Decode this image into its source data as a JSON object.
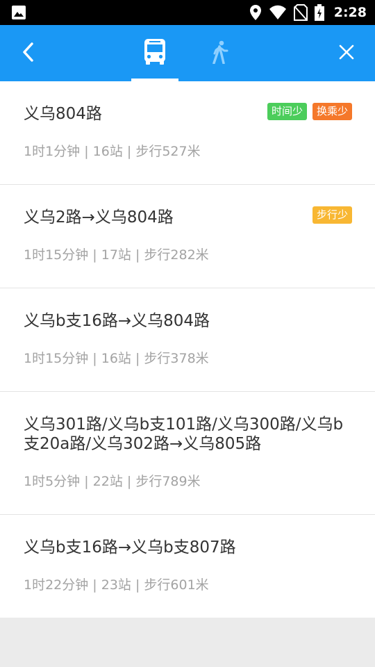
{
  "status_bar": {
    "time": "2:28",
    "icons": [
      "image-icon",
      "location-icon",
      "wifi-icon",
      "no-sim-icon",
      "battery-icon"
    ]
  },
  "app_bar": {
    "back_icon": "back-arrow-icon",
    "tabs": [
      {
        "icon": "bus-icon",
        "selected": true
      },
      {
        "icon": "walk-icon",
        "selected": false
      }
    ],
    "close_icon": "close-icon"
  },
  "colors": {
    "app_bar": "#1a98f5",
    "badge_green": "#4ccd5b",
    "badge_orange": "#f5782a",
    "badge_yellow": "#f8b733"
  },
  "routes": [
    {
      "title": "义乌804路",
      "meta": "1时1分钟 | 16站 | 步行527米",
      "badges": [
        "时间少",
        "换乘少"
      ]
    },
    {
      "title": "义乌2路→义乌804路",
      "meta": "1时15分钟 | 17站 | 步行282米",
      "badges": [
        "步行少"
      ]
    },
    {
      "title": "义乌b支16路→义乌804路",
      "meta": "1时15分钟 | 16站 | 步行378米",
      "badges": []
    },
    {
      "title_line1": "义乌301路/义乌b支101路/义乌300路/义乌b",
      "title_line2": "支20a路/义乌302路→义乌805路",
      "meta": "1时5分钟 | 22站 | 步行789米",
      "badges": []
    },
    {
      "title": "义乌b支16路→义乌b支807路",
      "meta": "1时22分钟 | 23站 | 步行601米",
      "badges": []
    }
  ]
}
